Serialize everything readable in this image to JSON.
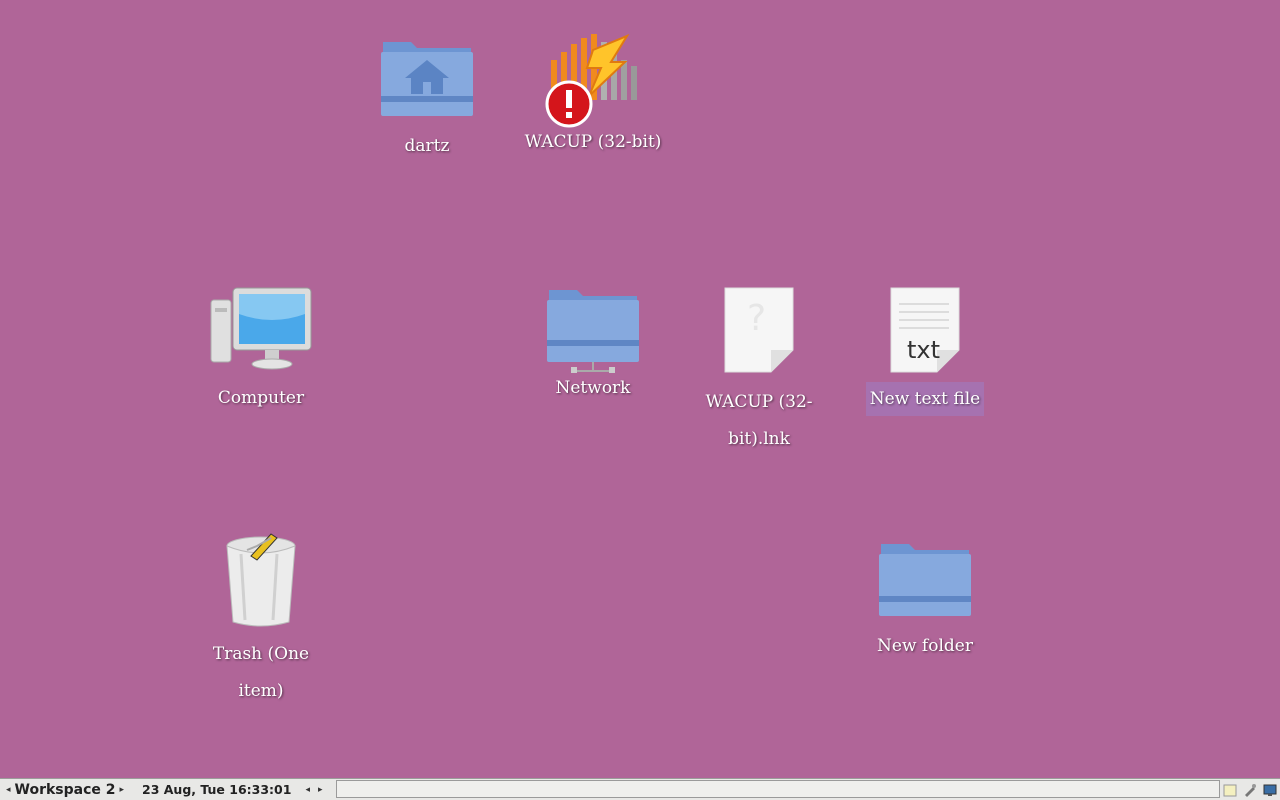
{
  "desktop": {
    "background": "#b06598",
    "icons": [
      {
        "label": "dartz"
      },
      {
        "label": "WACUP (32-bit)"
      },
      {
        "label": "Computer"
      },
      {
        "label": "Network"
      },
      {
        "label": "WACUP (32-bit).lnk"
      },
      {
        "label": "New text file",
        "selected": true,
        "badge": "txt"
      },
      {
        "label": "Trash (One item)"
      },
      {
        "label": "New folder"
      }
    ]
  },
  "taskbar": {
    "workspace": "Workspace 2",
    "clock": "23 Aug, Tue 16:33:01",
    "arrow_left": "◂",
    "arrow_right": "▸"
  }
}
